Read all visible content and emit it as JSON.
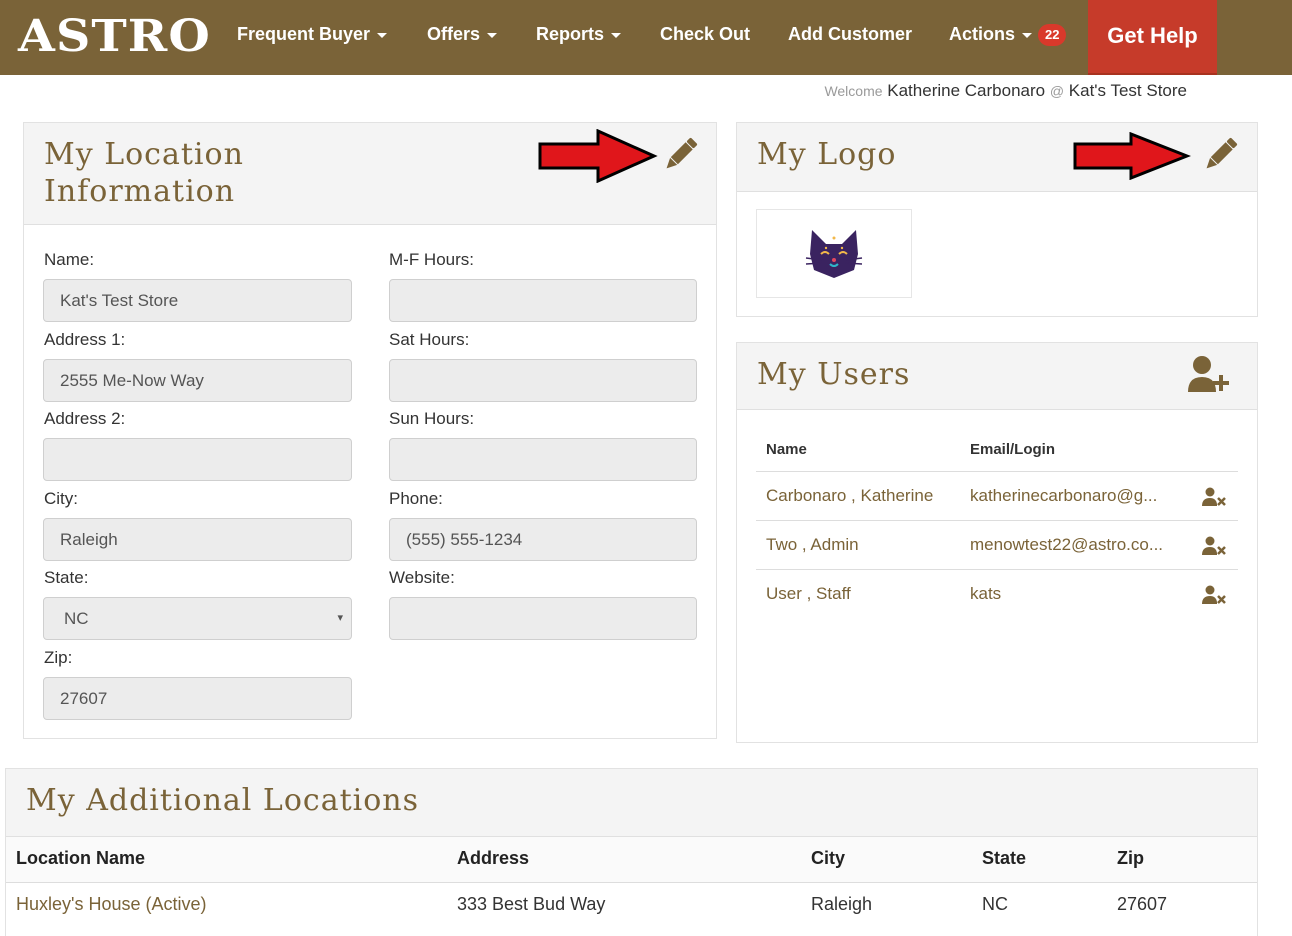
{
  "nav": {
    "brand": "ASTRO",
    "items": [
      {
        "label": "Frequent Buyer",
        "dropdown": true
      },
      {
        "label": "Offers",
        "dropdown": true
      },
      {
        "label": "Reports",
        "dropdown": true
      },
      {
        "label": "Check Out",
        "dropdown": false
      },
      {
        "label": "Add Customer",
        "dropdown": false
      },
      {
        "label": "Actions",
        "dropdown": true,
        "badge": "22"
      }
    ],
    "help": "Get Help"
  },
  "welcome": {
    "prefix": "Welcome",
    "user": "Katherine Carbonaro",
    "at": "@",
    "store": "Kat's Test Store"
  },
  "location": {
    "title_line1": "My Location",
    "title_line2": "Information",
    "edit_icon": "pencil-icon",
    "fields": {
      "name": {
        "label": "Name:",
        "value": "Kat's Test Store"
      },
      "address1": {
        "label": "Address 1:",
        "value": "2555 Me-Now Way"
      },
      "address2": {
        "label": "Address 2:",
        "value": ""
      },
      "city": {
        "label": "City:",
        "value": "Raleigh"
      },
      "state": {
        "label": "State:",
        "value": "NC",
        "arrow": "▾"
      },
      "zip": {
        "label": "Zip:",
        "value": "27607"
      },
      "mf_hours": {
        "label": "M-F Hours:",
        "value": ""
      },
      "sat_hours": {
        "label": "Sat Hours:",
        "value": ""
      },
      "sun_hours": {
        "label": "Sun Hours:",
        "value": ""
      },
      "phone": {
        "label": "Phone:",
        "value": "(555) 555-1234"
      },
      "website": {
        "label": "Website:",
        "value": ""
      }
    }
  },
  "logo": {
    "title": "My Logo",
    "edit_icon": "pencil-icon",
    "image": "cat-logo"
  },
  "users": {
    "title": "My Users",
    "add_icon": "add-user-icon",
    "headers": {
      "name": "Name",
      "email": "Email/Login"
    },
    "rows": [
      {
        "name": "Carbonaro , Katherine",
        "email": "katherinecarbonaro@g..."
      },
      {
        "name": "Two , Admin",
        "email": "menowtest22@astro.co..."
      },
      {
        "name": "User , Staff",
        "email": "kats"
      }
    ]
  },
  "additional": {
    "title": "My Additional Locations",
    "headers": {
      "name": "Location Name",
      "address": "Address",
      "city": "City",
      "state": "State",
      "zip": "Zip"
    },
    "rows": [
      {
        "name": "Huxley's House (Active)",
        "address": "333 Best Bud Way",
        "city": "Raleigh",
        "state": "NC",
        "zip": "27607"
      }
    ]
  },
  "colors": {
    "brand": "#7a6338",
    "help": "#c63b2a",
    "badge": "#d9392b",
    "arrow": "#e0161b"
  }
}
